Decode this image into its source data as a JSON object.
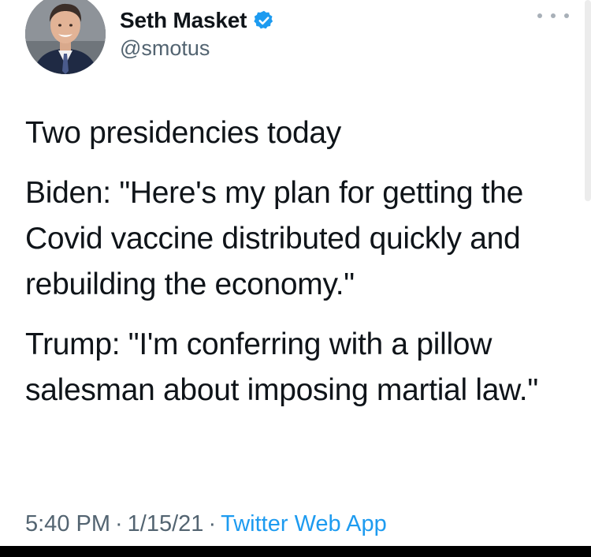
{
  "author": {
    "display_name": "Seth Masket",
    "handle": "@smotus",
    "verified_icon": "verified-badge-icon",
    "verified_color": "#1d9bf0"
  },
  "tweet": {
    "paragraphs": [
      "Two presidencies today",
      "Biden: \"Here's my plan for getting the Covid vaccine distributed quickly and rebuilding the economy.\"",
      "Trump: \"I'm conferring with a pillow salesman about imposing martial law.\""
    ]
  },
  "meta": {
    "time": "5:40 PM",
    "separator": "·",
    "date": "1/15/21",
    "source": "Twitter Web App"
  },
  "colors": {
    "text": "#0f1419",
    "secondary": "#536471",
    "link": "#1d9bf0"
  }
}
